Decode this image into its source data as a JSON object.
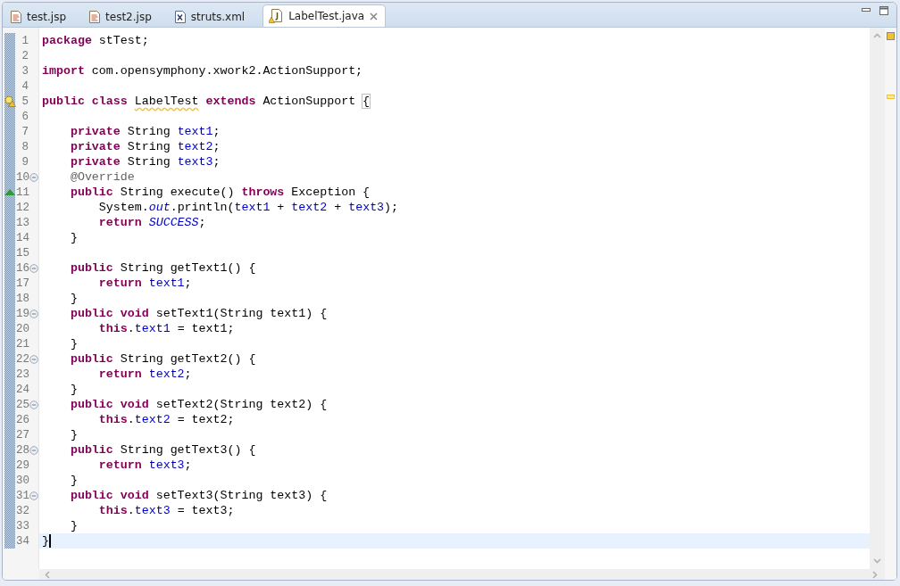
{
  "tabs": [
    {
      "label": "test.jsp",
      "kind": "jsp",
      "selected": false
    },
    {
      "label": "test2.jsp",
      "kind": "jsp",
      "selected": false
    },
    {
      "label": "struts.xml",
      "kind": "xml",
      "selected": false
    },
    {
      "label": "LabelTest.java",
      "kind": "java",
      "selected": true
    }
  ],
  "lines": [
    {
      "n": "1",
      "fold": false,
      "current": false,
      "tokens": [
        {
          "kind": "kw",
          "text": "package"
        },
        {
          "kind": "p",
          "text": " stTest;"
        }
      ]
    },
    {
      "n": "2",
      "fold": false
    },
    {
      "n": "3",
      "fold": false,
      "current": false,
      "tokens": [
        {
          "kind": "kw",
          "text": "import"
        },
        {
          "kind": "p",
          "text": " com.opensymphony.xwork2.ActionSupport;"
        }
      ]
    },
    {
      "n": "4",
      "fold": false
    },
    {
      "n": "5",
      "kind": "warning",
      "fold": false,
      "current": false,
      "tokens": [
        {
          "kind": "kw",
          "text": "public class "
        },
        {
          "kind": "warn",
          "text": "LabelTest"
        },
        {
          "kind": "kw",
          "text": " extends"
        },
        {
          "kind": "p",
          "text": " ActionSupport "
        },
        {
          "kind": "bracket",
          "text": "{"
        }
      ]
    },
    {
      "n": "6",
      "fold": false
    },
    {
      "n": "7",
      "fold": false,
      "current": false,
      "tokens": [
        {
          "kind": "kw",
          "text": "    private"
        },
        {
          "kind": "p",
          "text": " String "
        },
        {
          "kind": "field",
          "text": "text1"
        },
        {
          "kind": "p",
          "text": ";"
        }
      ]
    },
    {
      "n": "8",
      "fold": false,
      "current": false,
      "tokens": [
        {
          "kind": "kw",
          "text": "    private"
        },
        {
          "kind": "p",
          "text": " String "
        },
        {
          "kind": "field",
          "text": "text2"
        },
        {
          "kind": "p",
          "text": ";"
        }
      ]
    },
    {
      "n": "9",
      "fold": false,
      "current": false,
      "tokens": [
        {
          "kind": "kw",
          "text": "    private"
        },
        {
          "kind": "p",
          "text": " String "
        },
        {
          "kind": "field",
          "text": "text3"
        },
        {
          "kind": "p",
          "text": ";"
        }
      ]
    },
    {
      "n": "10",
      "fold": true,
      "current": false,
      "tokens": [
        {
          "kind": "ann",
          "text": "    @Override"
        }
      ]
    },
    {
      "n": "11",
      "kind": "override",
      "fold": false,
      "current": false,
      "tokens": [
        {
          "kind": "kw",
          "text": "    public"
        },
        {
          "kind": "p",
          "text": " String execute() "
        },
        {
          "kind": "kw",
          "text": "throws"
        },
        {
          "kind": "p",
          "text": " Exception {"
        }
      ]
    },
    {
      "n": "12",
      "fold": false,
      "current": false,
      "tokens": [
        {
          "kind": "p",
          "text": "        System."
        },
        {
          "kind": "static",
          "text": "out"
        },
        {
          "kind": "p",
          "text": ".println("
        },
        {
          "kind": "field",
          "text": "text1"
        },
        {
          "kind": "p",
          "text": " + "
        },
        {
          "kind": "field",
          "text": "text2"
        },
        {
          "kind": "p",
          "text": " + "
        },
        {
          "kind": "field",
          "text": "text3"
        },
        {
          "kind": "p",
          "text": ");"
        }
      ]
    },
    {
      "n": "13",
      "fold": false,
      "current": false,
      "tokens": [
        {
          "kind": "kw",
          "text": "        return "
        },
        {
          "kind": "static",
          "text": "SUCCESS"
        },
        {
          "kind": "p",
          "text": ";"
        }
      ]
    },
    {
      "n": "14",
      "fold": false,
      "current": false,
      "tokens": [
        {
          "kind": "p",
          "text": "    }"
        }
      ]
    },
    {
      "n": "15",
      "fold": false
    },
    {
      "n": "16",
      "fold": true,
      "current": false,
      "tokens": [
        {
          "kind": "kw",
          "text": "    public"
        },
        {
          "kind": "p",
          "text": " String getText1() {"
        }
      ]
    },
    {
      "n": "17",
      "fold": false,
      "current": false,
      "tokens": [
        {
          "kind": "kw",
          "text": "        return "
        },
        {
          "kind": "field",
          "text": "text1"
        },
        {
          "kind": "p",
          "text": ";"
        }
      ]
    },
    {
      "n": "18",
      "fold": false,
      "current": false,
      "tokens": [
        {
          "kind": "p",
          "text": "    }"
        }
      ]
    },
    {
      "n": "19",
      "fold": true,
      "current": false,
      "tokens": [
        {
          "kind": "kw",
          "text": "    public void"
        },
        {
          "kind": "p",
          "text": " setText1(String text1) {"
        }
      ]
    },
    {
      "n": "20",
      "fold": false,
      "current": false,
      "tokens": [
        {
          "kind": "kw",
          "text": "        this"
        },
        {
          "kind": "p",
          "text": "."
        },
        {
          "kind": "field",
          "text": "text1"
        },
        {
          "kind": "p",
          "text": " = text1;"
        }
      ]
    },
    {
      "n": "21",
      "fold": false,
      "current": false,
      "tokens": [
        {
          "kind": "p",
          "text": "    }"
        }
      ]
    },
    {
      "n": "22",
      "fold": true,
      "current": false,
      "tokens": [
        {
          "kind": "kw",
          "text": "    public"
        },
        {
          "kind": "p",
          "text": " String getText2() {"
        }
      ]
    },
    {
      "n": "23",
      "fold": false,
      "current": false,
      "tokens": [
        {
          "kind": "kw",
          "text": "        return "
        },
        {
          "kind": "field",
          "text": "text2"
        },
        {
          "kind": "p",
          "text": ";"
        }
      ]
    },
    {
      "n": "24",
      "fold": false,
      "current": false,
      "tokens": [
        {
          "kind": "p",
          "text": "    }"
        }
      ]
    },
    {
      "n": "25",
      "fold": true,
      "current": false,
      "tokens": [
        {
          "kind": "kw",
          "text": "    public void"
        },
        {
          "kind": "p",
          "text": " setText2(String text2) {"
        }
      ]
    },
    {
      "n": "26",
      "fold": false,
      "current": false,
      "tokens": [
        {
          "kind": "kw",
          "text": "        this"
        },
        {
          "kind": "p",
          "text": "."
        },
        {
          "kind": "field",
          "text": "text2"
        },
        {
          "kind": "p",
          "text": " = text2;"
        }
      ]
    },
    {
      "n": "27",
      "fold": false,
      "current": false,
      "tokens": [
        {
          "kind": "p",
          "text": "    }"
        }
      ]
    },
    {
      "n": "28",
      "fold": true,
      "current": false,
      "tokens": [
        {
          "kind": "kw",
          "text": "    public"
        },
        {
          "kind": "p",
          "text": " String getText3() {"
        }
      ]
    },
    {
      "n": "29",
      "fold": false,
      "current": false,
      "tokens": [
        {
          "kind": "kw",
          "text": "        return "
        },
        {
          "kind": "field",
          "text": "text3"
        },
        {
          "kind": "p",
          "text": ";"
        }
      ]
    },
    {
      "n": "30",
      "fold": false,
      "current": false,
      "tokens": [
        {
          "kind": "p",
          "text": "    }"
        }
      ]
    },
    {
      "n": "31",
      "fold": true,
      "current": false,
      "tokens": [
        {
          "kind": "kw",
          "text": "    public void"
        },
        {
          "kind": "p",
          "text": " setText3(String text3) {"
        }
      ]
    },
    {
      "n": "32",
      "fold": false,
      "current": false,
      "tokens": [
        {
          "kind": "kw",
          "text": "        this"
        },
        {
          "kind": "p",
          "text": "."
        },
        {
          "kind": "field",
          "text": "text3"
        },
        {
          "kind": "p",
          "text": " = text3;"
        }
      ]
    },
    {
      "n": "33",
      "fold": false,
      "current": false,
      "tokens": [
        {
          "kind": "p",
          "text": "    }"
        }
      ]
    },
    {
      "n": "34",
      "fold": false,
      "current": true,
      "tokens": [
        {
          "kind": "p",
          "text": "}"
        }
      ]
    }
  ]
}
